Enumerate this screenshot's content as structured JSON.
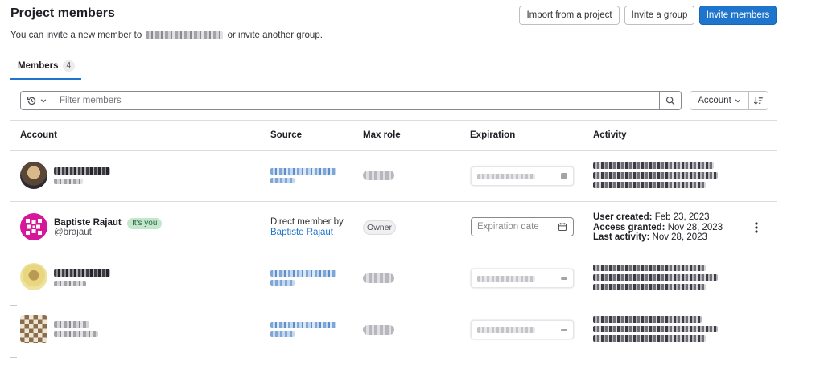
{
  "header": {
    "title": "Project members",
    "subtitle_prefix": "You can invite a new member to",
    "subtitle_suffix": "or invite another group."
  },
  "buttons": {
    "import": "Import from a project",
    "invite_group": "Invite a group",
    "invite_members": "Invite members"
  },
  "tabs": [
    {
      "label": "Members",
      "count": "4"
    }
  ],
  "filter": {
    "placeholder": "Filter members",
    "sort_label": "Account"
  },
  "columns": [
    "Account",
    "Source",
    "Max role",
    "Expiration",
    "Activity"
  ],
  "current_user": {
    "name": "Baptiste Rajaut",
    "badge": "It's you",
    "handle": "@brajaut",
    "source_prefix": "Direct member by",
    "source_link": "Baptiste Rajaut",
    "role": "Owner",
    "expiration_placeholder": "Expiration date",
    "activity": [
      {
        "label": "User created:",
        "value": "Feb 23, 2023"
      },
      {
        "label": "Access granted:",
        "value": "Nov 28, 2023"
      },
      {
        "label": "Last activity:",
        "value": "Nov 28, 2023"
      }
    ]
  },
  "colors": {
    "primary": "#1f75cb",
    "avatar_magenta": "#d6169b",
    "you_badge_bg": "#c3e6cd"
  },
  "icons": [
    "history-icon",
    "chevron-down-icon",
    "search-icon",
    "sort-icon",
    "calendar-icon",
    "kebab-icon"
  ]
}
